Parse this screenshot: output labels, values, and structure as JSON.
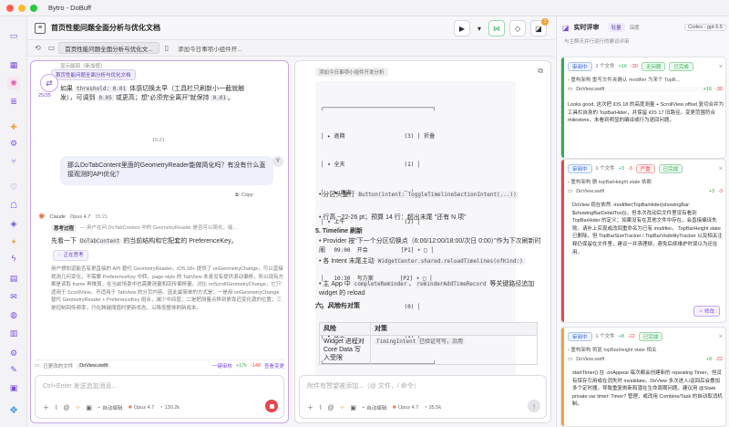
{
  "app": {
    "title": "Bytro - DoBuff"
  },
  "colors": {
    "accent": "#7b4ee0",
    "red": "#ff5f57",
    "yellow": "#febc2e",
    "green": "#28c840",
    "success": "#2eae4f",
    "danger": "#e5484d",
    "warn": "#f2a33a"
  },
  "header": {
    "doc_title": "首页性能问题全面分析与优化文档",
    "badge_count": "1"
  },
  "tabs": [
    {
      "label": "首页性能问题全面分析与优化文..."
    },
    {
      "label": "添加今日事项小组件开..."
    }
  ],
  "left_pane": {
    "thread_label": "首页性能问题全面分析与优化文档",
    "cut_line": "显示能回（新加值）",
    "para1_a": "如果",
    "para1_code1": "threshold: 0.01",
    "para1_b": "体感切换太早（工具栏只刷新小一截就触",
    "para1_c": "发），可调到",
    "para1_code2": "0.05",
    "para1_d": "或更高；想“必须完全离开”就保持",
    "para1_code3": "0.01",
    "para1_e": "。",
    "side_counter": "25/35",
    "timestamp": "15:21",
    "user_message": "那么DoTabContent里面的GeometryReader能做简化吗？有没有什么直接观测的API优化？",
    "user_avatar": "Y",
    "copy_label": "Copy",
    "assistant_name": "Claude",
    "assistant_model": "Opus 4.7",
    "assistant_time": "15:21",
    "thinking_label": "思考过程",
    "thinking_text": "— 用户在问 DoTabContent 中的 GeometryReader 是否可以简化，能...",
    "answer_a": "先看一下",
    "answer_code": "DoTabContent",
    "answer_b": "的当前结构和它配套的 PreferenceKey。",
    "search_chip": "正在思考",
    "dense_text": "用户想知道能否有更直接的 API 替代 GeometryReader。iOS 18+ 提供了 onGeometryChange，可以直接观测几何变化，不需要 PreferenceKey 中转。page-style 的 TabView 本身没有提供滚动偏移，所以现有方案是读取 frame 再推算，在当前场景中也需要测量和回传偏移量。对比 onScrollGeometryChange，它只适用于 ScrollView，不适用于 TabView 的分页内容。因此最简单的方式是：一是用 onGeometryChange 替代 GeometryReader + PreferenceKey 组合，减少中间层；二是把测量点移到更靠近变化源的位置；三是控制回传频率，只在跨越阈值时更新状态，以降低整体刷新成本。",
    "file_bar": {
      "prefix": "已更改的文件",
      "file": "DoView.swift",
      "action": "一键审核",
      "added": "+17k",
      "removed": "-148",
      "review": "查看变更"
    },
    "composer": {
      "placeholder": "Ctrl+Enter 发送追加消息...",
      "mode": "自动编辑",
      "model": "Opus 4.7",
      "tokens": "130.2k"
    }
  },
  "right_pane": {
    "header_label": "添加今日事项小组件开发分析",
    "tree_lines": [
      "┌─────────────────────────────────┐",
      "│ ▸ 逾期                  (3) │ 折叠",
      "│ ▾ 全天                  (1) │",
      "│   ▪ 周末              ☀ □ │",
      "│ ▾ 上午                  (2) │",
      "│   09:00  开会          [P1] ☀ □ │",
      "│   10:30  写方案        [P2] ☀ □ │",
      "│ ▸ 下午                  (0) │",
      "│ ▸ 晚上                  (1) │",
      "└─────────────────────────────────┘"
    ],
    "b1_a": "分区头整行",
    "b1_code": "Button(intent: ToggleTimelineSectionIntent(...))",
    "b2": "行高 ~22-26 pt；预算 14 行：超出末尾 \"还有 N 项\"",
    "section5": "5. Timeline 刷新",
    "s5_b1": "Provider 按“下一个分区切换点（6:00/12:00/18:00/次日 0:00）”作为下次刷新时间",
    "s5_b2_a": "各 Intent 末尾主动",
    "s5_b2_code": "WidgetCenter.shared.reloadTimelines(ofKind:)",
    "s5_b3_a": "主 App 中",
    "s5_b3_code1": "completeReminder",
    "s5_b3_sep": "、",
    "s5_b3_code2": "reminderAddTimeRecord",
    "s5_b3_b": "等关键路径追加 widget 的 reload",
    "section6": "六、风险与对策",
    "table_headers": [
      "风险",
      "对策"
    ],
    "table_row": [
      "Widget 进程对 Core Data 写入受限",
      "TimingIntent 已验证可写，沿用"
    ],
    "composer": {
      "placeholder": "附件有赞望被添加...（@ 文件，/ 命令）",
      "mode": "自动编辑",
      "model": "Opus 4.7",
      "tokens": "35.5k"
    }
  },
  "review": {
    "title": "实时评审",
    "tabs": [
      "轻量",
      "深度"
    ],
    "model": "Codex · gpt-5.5",
    "subtitle": "与主聊天并行运行的建议评审",
    "cards": [
      {
        "status": "审阅中",
        "files": "1 个文件",
        "added": "+16",
        "removed": "-30",
        "verdict": "无问题",
        "state": "已完成",
        "desc": "重构架构 重写文件夹确认 modifier 为来个 TopB...",
        "file": "DoView.swift",
        "file_added": "+16",
        "file_removed": "-30",
        "body": "Looks good. 这次把 iOS 18 的高度测量 + ScrollView offset 复切合并为工具栏自身的 TopBarHider，并保留 iOS 17 旧路径。变更范围符合 milestone，未看到明显的编译或行为退回问题。"
      },
      {
        "status": "审阅中",
        "files": "1 个文件",
        "added": "+3",
        "removed": "-3",
        "verdict": "严重",
        "state": "已完成",
        "desc": "重构架构 删 topBarHeight state 依赖",
        "file": "DoView.swift",
        "file_added": "+3",
        "file_removed": "-3",
        "body": "DoView 现在依然 .modifier(TopBarHider(showingBar: $showingBarDetailTool))，但本次改动后文件里没有看到 TopBarHider 的定义；如果没有在其他文件中存在，会直接编译失败。请补上实现或改回重命名为已有 modifier。 TopBarHeight state 已删除，但 TopBarSizeTracker / TopBarVisibilityTracker 以及相关注释仍保留在文件里，建议一并清理掉，避免后续维护时误以为还在用。",
        "action": "修改"
      },
      {
        "status": "审阅中",
        "files": "1 个文件",
        "added": "+8",
        "removed": "-22",
        "verdict": "",
        "state": "已完成",
        "desc": "重构架构 将复 topBarHeight state 相关",
        "file": "DoView.swift",
        "file_added": "+8",
        "file_removed": "-22",
        "body": "startTimer() 在 .onAppear 每次都会创建新的 repeating Timer，但没有保存引用或在消失时 invalidate。DoView 多次进入/返回后会叠加多个定时器，导致重复刷新和潜在生命周期问题。建议用 @State private var timer: Timer? 管理，或改用 Combine/Task 的自动取消机制。"
      }
    ]
  }
}
